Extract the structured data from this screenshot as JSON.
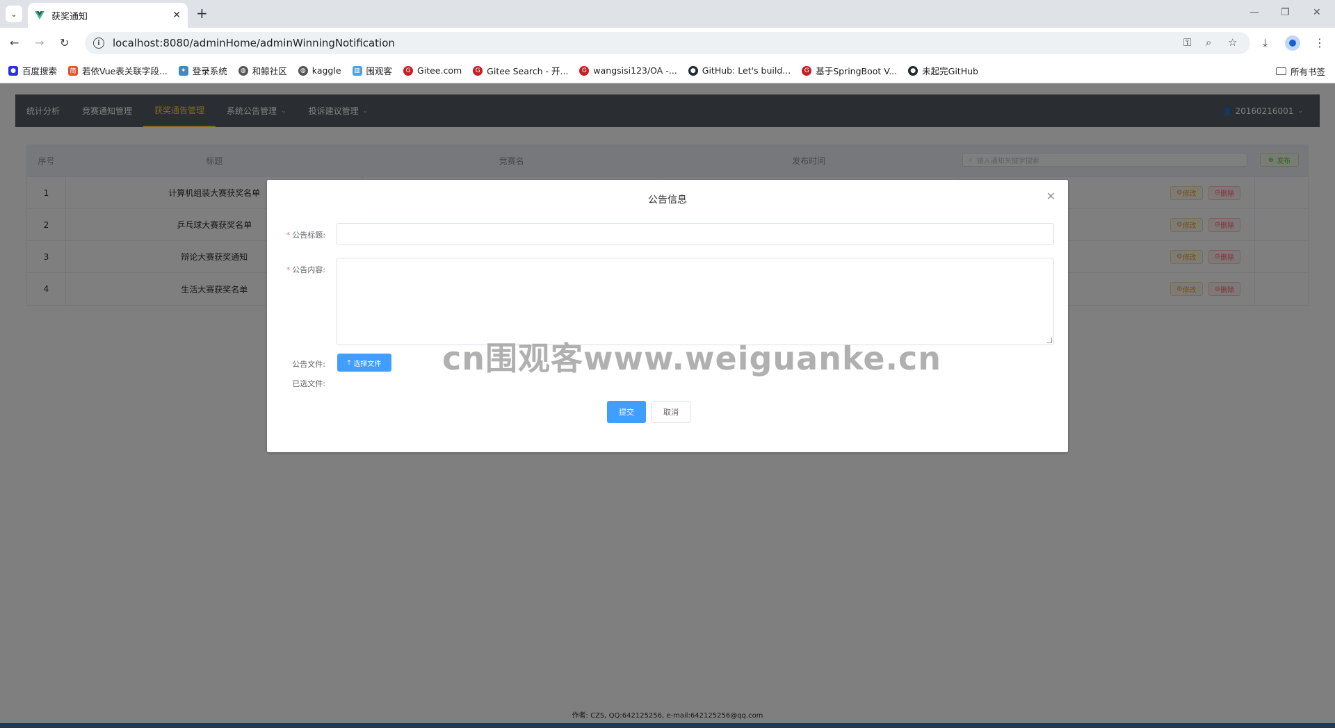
{
  "browser": {
    "tab_title": "获奖通知",
    "url": "localhost:8080/adminHome/adminWinningNotification",
    "bookmarks": [
      {
        "label": "百度搜索",
        "color": "#2932e1"
      },
      {
        "label": "若依Vue表关联字段...",
        "color": "#e3542c"
      },
      {
        "label": "登录系统",
        "color": "#3c8dbc"
      },
      {
        "label": "和鲸社区",
        "color": "#555555"
      },
      {
        "label": "kaggle",
        "color": "#555555"
      },
      {
        "label": "围观客",
        "color": "#4aa3df"
      },
      {
        "label": "Gitee.com",
        "color": "#c71d23"
      },
      {
        "label": "Gitee Search - 开...",
        "color": "#c71d23"
      },
      {
        "label": "wangsisi123/OA -...",
        "color": "#c71d23"
      },
      {
        "label": "GitHub: Let's build...",
        "color": "#24292e"
      },
      {
        "label": "基于SpringBoot V...",
        "color": "#c71d23"
      },
      {
        "label": "未起完GitHub",
        "color": "#24292e"
      }
    ],
    "all_bookmarks": "所有书签"
  },
  "nav": {
    "items": [
      {
        "label": "统计分析",
        "active": false,
        "caret": false
      },
      {
        "label": "竞赛通知管理",
        "active": false,
        "caret": false
      },
      {
        "label": "获奖通告管理",
        "active": true,
        "caret": false
      },
      {
        "label": "系统公告管理",
        "active": false,
        "caret": true
      },
      {
        "label": "投诉建议管理",
        "active": false,
        "caret": true
      }
    ],
    "user": "20160216001"
  },
  "table": {
    "headers": [
      "序号",
      "标题",
      "竞赛名",
      "发布时间"
    ],
    "search_placeholder": "输入通知关键字搜索",
    "publish_label": "发布",
    "edit_label": "修改",
    "delete_label": "删除",
    "rows": [
      {
        "idx": "1",
        "title": "计算机组装大赛获奖名单"
      },
      {
        "idx": "2",
        "title": "乒乓球大赛获奖名单"
      },
      {
        "idx": "3",
        "title": "辩论大赛获奖通知"
      },
      {
        "idx": "4",
        "title": "生活大赛获奖名单"
      }
    ]
  },
  "dialog": {
    "title": "公告信息",
    "label_title": "公告标题:",
    "label_content": "公告内容:",
    "label_file": "公告文件:",
    "label_selected": "已选文件:",
    "upload_label": "选择文件",
    "submit_label": "提交",
    "cancel_label": "取消"
  },
  "footer": "作者: CZS, QQ:642125256, e-mail:642125256@qq.com",
  "watermark": "cn围观客www.weiguanke.cn"
}
